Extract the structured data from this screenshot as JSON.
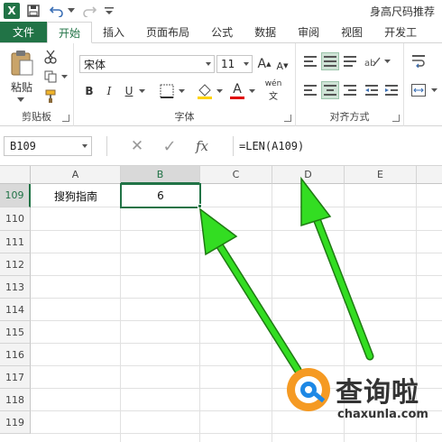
{
  "title_bar": {
    "right_text": "身高尺码推荐"
  },
  "tabs": [
    {
      "label": "文件"
    },
    {
      "label": "开始"
    },
    {
      "label": "插入"
    },
    {
      "label": "页面布局"
    },
    {
      "label": "公式"
    },
    {
      "label": "数据"
    },
    {
      "label": "审阅"
    },
    {
      "label": "视图"
    },
    {
      "label": "开发工"
    }
  ],
  "ribbon": {
    "clipboard": {
      "paste_label": "粘贴",
      "group_label": "剪贴板"
    },
    "font": {
      "font_name": "宋体",
      "font_size": "11",
      "bold": "B",
      "italic": "I",
      "underline": "U",
      "group_label": "字体",
      "grow": "A",
      "shrink": "A",
      "font_color": "A",
      "phonetic": "wén"
    },
    "alignment": {
      "group_label": "对齐方式"
    }
  },
  "formula_bar": {
    "name_box": "B109",
    "cancel": "✕",
    "enter": "✓",
    "fx": "fx",
    "formula": "=LEN(A109)"
  },
  "grid": {
    "columns": [
      "A",
      "B",
      "C",
      "D",
      "E"
    ],
    "rows": [
      "109",
      "110",
      "111",
      "112",
      "113",
      "114",
      "115",
      "116",
      "117",
      "118",
      "119"
    ],
    "cells": {
      "A109": "搜狗指南",
      "B109": "6"
    }
  },
  "watermark": {
    "brand": "查询啦",
    "url": "chaxunla.com"
  },
  "colors": {
    "accent": "#217346",
    "arrow": "#33dd22"
  }
}
